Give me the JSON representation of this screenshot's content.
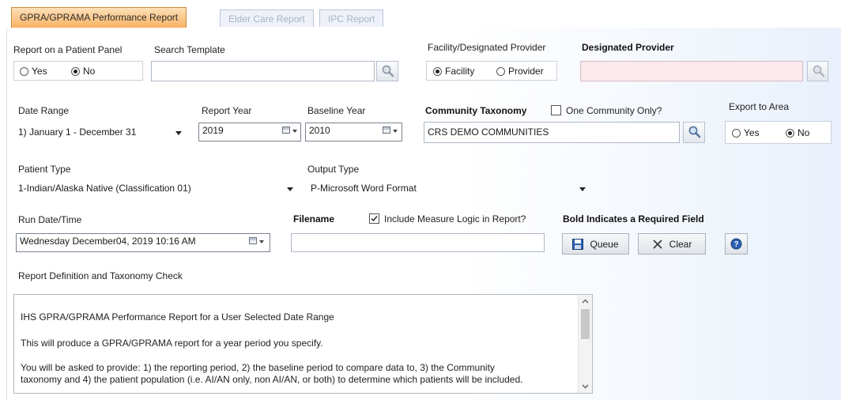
{
  "tabs": [
    "GPRA/GPRAMA Performance Report",
    "Elder Care Report",
    "IPC Report"
  ],
  "panel_label": "Report on a Patient Panel",
  "panel_yes": "Yes",
  "panel_no": "No",
  "search_template_label": "Search Template",
  "search_template_value": "",
  "facility_provider_label": "Facility/Designated Provider",
  "facility_option": "Facility",
  "provider_option": "Provider",
  "designated_provider_label": "Designated Provider",
  "designated_provider_value": "",
  "date_range_label": "Date Range",
  "date_range_value": "1) January 1 - December 31",
  "report_year_label": "Report Year",
  "report_year_value": "2019",
  "baseline_year_label": "Baseline Year",
  "baseline_year_value": "2010",
  "community_taxonomy_label": "Community Taxonomy",
  "one_community_label": "One Community Only?",
  "community_taxonomy_value": "CRS DEMO COMMUNITIES",
  "export_area_label": "Export to Area",
  "export_yes": "Yes",
  "export_no": "No",
  "patient_type_label": "Patient Type",
  "patient_type_value": "1-Indian/Alaska Native (Classification 01)",
  "output_type_label": "Output Type",
  "output_type_value": "P-Microsoft Word Format",
  "run_datetime_label": "Run Date/Time",
  "run_datetime_value": "Wednesday  December04, 2019  10:16 AM",
  "filename_label": "Filename",
  "filename_value": "",
  "include_logic_label": "Include Measure Logic in Report?",
  "required_note": "Bold Indicates a Required Field",
  "queue_label": "Queue",
  "clear_label": "Clear",
  "definition_label": "Report Definition and Taxonomy Check",
  "definition_lines": [
    "IHS GPRA/GPRAMA Performance Report for a User Selected Date Range",
    "This will produce a GPRA/GPRAMA report for a year period you specify.",
    "You will be asked to provide: 1) the reporting period, 2) the baseline period to compare data to, 3) the Community",
    "taxonomy and 4) the patient population (i.e. AI/AN only, non AI/AN, or both) to determine which patients will be included."
  ],
  "colors": {
    "active_tab": "#f7b264",
    "required_bg": "#fbe9ee",
    "accent_blue": "#2a5fb0"
  }
}
